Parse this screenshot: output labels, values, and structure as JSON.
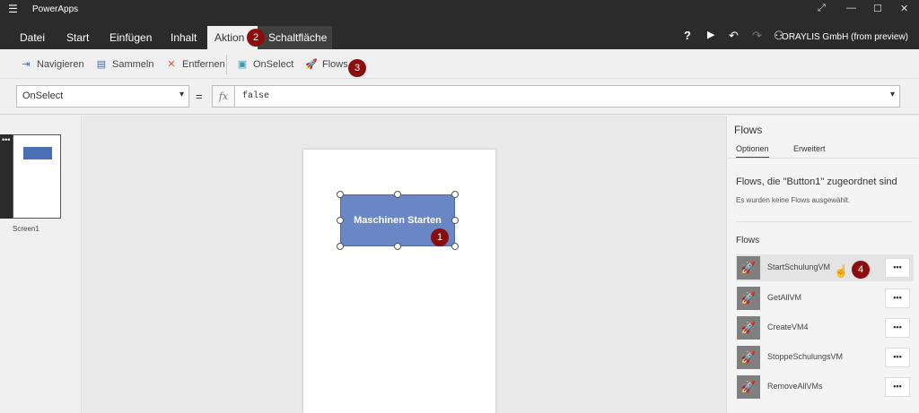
{
  "app": {
    "title": "PowerApps",
    "user": "ORAYLIS GmbH (from preview)"
  },
  "tabs": [
    {
      "label": "Datei"
    },
    {
      "label": "Start"
    },
    {
      "label": "Einfügen"
    },
    {
      "label": "Inhalt"
    },
    {
      "label": "Aktion"
    },
    {
      "label": "Schaltfläche"
    }
  ],
  "ribbon": {
    "navigate": "Navigieren",
    "collect": "Sammeln",
    "remove": "Entfernen",
    "onselect": "OnSelect",
    "flows": "Flows"
  },
  "formulabar": {
    "property": "OnSelect",
    "equals": "=",
    "fx": "fx",
    "formula": "false"
  },
  "screens": {
    "thumb_menu": "•••",
    "items": [
      {
        "label": "Screen1"
      }
    ]
  },
  "canvas": {
    "button_label": "Maschinen Starten"
  },
  "badges": [
    "1",
    "2",
    "3",
    "4"
  ],
  "flows_panel": {
    "title": "Flows",
    "tab_options": "Optionen",
    "tab_advanced": "Erweitert",
    "heading": "Flows, die \"Button1\" zugeordnet sind",
    "note": "Es wurden keine Flows ausgewählt.",
    "flows_label": "Flows",
    "more": "•••",
    "items": [
      {
        "name": "StartSchulungVM"
      },
      {
        "name": "GetAllVM"
      },
      {
        "name": "CreateVM4"
      },
      {
        "name": "StoppeSchulungsVM"
      },
      {
        "name": "RemoveAllVMs"
      }
    ]
  },
  "colors": {
    "titlebar": "#2b2b2b",
    "button": "#6b86c5",
    "badge": "#8b0e0e",
    "accent_tab": "#742774"
  }
}
